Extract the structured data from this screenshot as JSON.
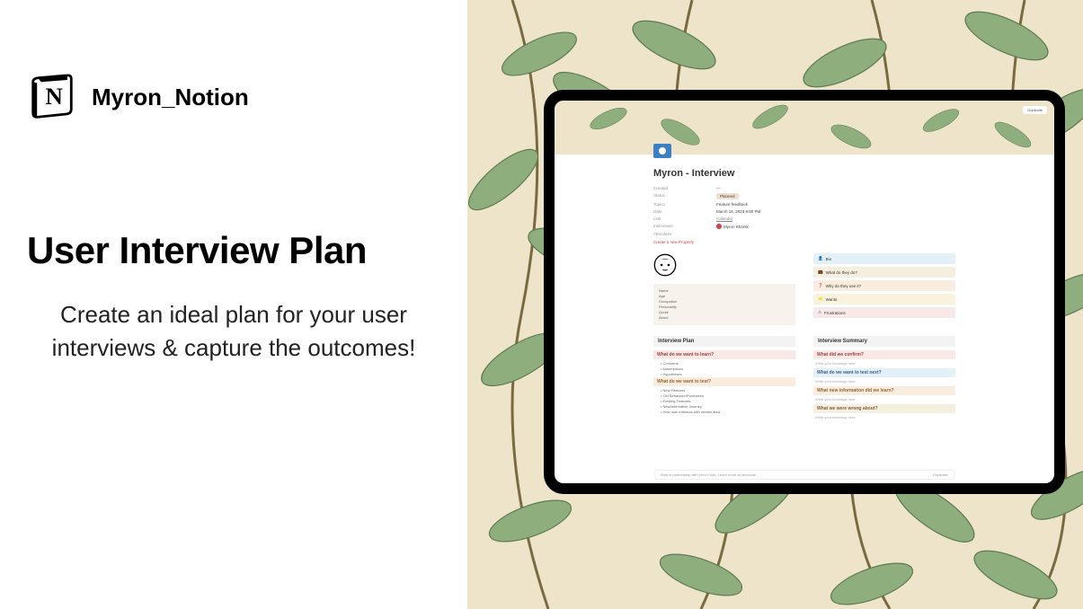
{
  "brand": {
    "name": "Myron_Notion"
  },
  "headline": "User Interview Plan",
  "subtext": "Create an ideal plan for your user interviews & capture the outcomes!",
  "tablet": {
    "top_button": "Duplicate",
    "page_title": "Myron - Interview",
    "props": [
      {
        "label": "Created",
        "value": "—",
        "style": "red"
      },
      {
        "label": "Status",
        "value": "Planned",
        "style": "pill"
      },
      {
        "label": "Topics",
        "value": "Feature feedback"
      },
      {
        "label": "Date",
        "value": "March 16, 2023 9:00 PM"
      },
      {
        "label": "Link",
        "value": "Calendar",
        "style": "link"
      },
      {
        "label": "Interviewer",
        "value": "Myron Kharsk",
        "style": "icon-row"
      },
      {
        "label": "Attendees",
        "value": ""
      }
    ],
    "add_prop": "Create a new Property",
    "toc": [
      "Name",
      "Age",
      "Occupation",
      "Personality",
      "Quote",
      "About"
    ],
    "callouts": [
      {
        "label": "Bio",
        "style": "c-blue"
      },
      {
        "label": "What do they do?",
        "style": "c-beige"
      },
      {
        "label": "Why do they use it?",
        "style": "c-orange"
      },
      {
        "label": "Wants",
        "style": "c-yellow"
      },
      {
        "label": "Frustrations",
        "style": "c-pink"
      }
    ],
    "plan": {
      "heading": "Interview Plan",
      "q1": {
        "title": "What do we want to learn?",
        "items": [
          "Concerns",
          "Assumptions",
          "Hypotheses"
        ]
      },
      "q2": {
        "title": "What do we want to test?",
        "items": [
          "New Features",
          "Old Behaviour/Purchases",
          "Existing Features",
          "New/Alternative Journey",
          "How user interacts with certain area"
        ]
      }
    },
    "summary": {
      "heading": "Interview Summary",
      "q1": {
        "title": "What did we confirm?",
        "ph": "Write your learnings here"
      },
      "q2": {
        "title": "What do we want to test next?",
        "ph": "Write your learnings here"
      },
      "q3": {
        "title": "What new information did we learn?",
        "ph": "Write your learnings here"
      },
      "q4": {
        "title": "What we were wrong about?",
        "ph": "Write your learnings here"
      }
    },
    "footer": {
      "left": "Built in partnership with Zero Code. Learn more at zerocode",
      "right": "Duplicate"
    }
  }
}
